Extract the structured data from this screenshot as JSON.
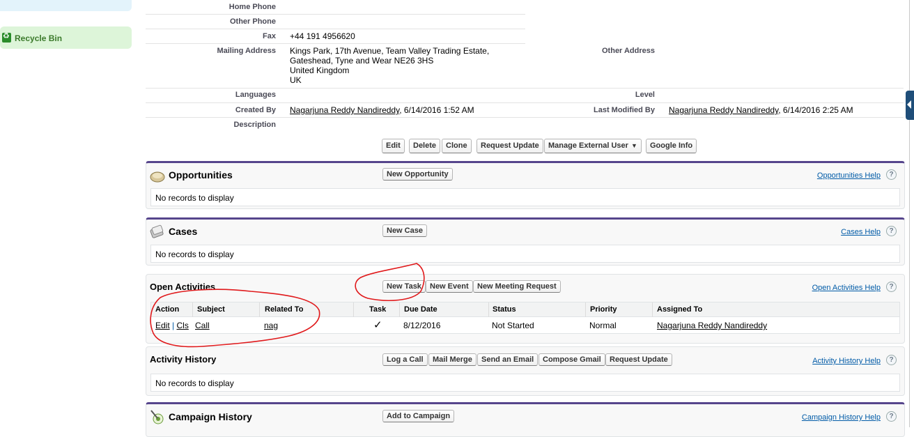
{
  "sidebar": {
    "recycle_bin_label": "Recycle Bin"
  },
  "details": {
    "home_phone_label": "Home Phone",
    "other_phone_label": "Other Phone",
    "fax_label": "Fax",
    "fax_value": "+44 191 4956620",
    "mailing_address_label": "Mailing Address",
    "mailing_address_lines": [
      "Kings Park, 17th Avenue, Team Valley Trading Estate,",
      "Gateshead, Tyne and Wear NE26 3HS",
      "United Kingdom",
      "UK"
    ],
    "other_address_label": "Other Address",
    "languages_label": "Languages",
    "level_label": "Level",
    "created_by_label": "Created By",
    "created_by_user": "Nagarjuna Reddy Nandireddy",
    "created_by_date": ", 6/14/2016 1:52 AM",
    "last_modified_by_label": "Last Modified By",
    "last_modified_by_user": "Nagarjuna Reddy Nandireddy",
    "last_modified_by_date": ", 6/14/2016 2:25 AM",
    "description_label": "Description"
  },
  "detail_buttons": {
    "edit": "Edit",
    "delete": "Delete",
    "clone": "Clone",
    "request_update": "Request Update",
    "manage_external_user": "Manage External User",
    "google_info": "Google Info"
  },
  "opportunities": {
    "title": "Opportunities",
    "new_button": "New Opportunity",
    "help": "Opportunities Help",
    "empty": "No records to display"
  },
  "cases": {
    "title": "Cases",
    "new_button": "New Case",
    "help": "Cases Help",
    "empty": "No records to display"
  },
  "open_activities": {
    "title": "Open Activities",
    "new_task_button": "New Task",
    "new_event_button": "New Event",
    "new_meeting_request_button": "New Meeting Request",
    "help": "Open Activities Help",
    "columns": [
      "Action",
      "Subject",
      "Related To",
      "Task",
      "Due Date",
      "Status",
      "Priority",
      "Assigned To"
    ],
    "row": {
      "action_edit": "Edit",
      "action_sep": " | ",
      "action_close": "Cls",
      "subject": "Call",
      "related_to": "nag",
      "task_check": "✓",
      "due_date": "8/12/2016",
      "status": "Not Started",
      "priority": "Normal",
      "assigned_to": "Nagarjuna Reddy Nandireddy"
    }
  },
  "activity_history": {
    "title": "Activity History",
    "buttons": {
      "log_a_call": "Log a Call",
      "mail_merge": "Mail Merge",
      "send_an_email": "Send an Email",
      "compose_gmail": "Compose Gmail",
      "request_update": "Request Update"
    },
    "help": "Activity History Help",
    "empty": "No records to display"
  },
  "campaign_history": {
    "title": "Campaign History",
    "add_button": "Add to Campaign",
    "help": "Campaign History Help"
  },
  "help_glyph": "?",
  "colors": {
    "related_list_border": "#56458c",
    "help_link": "#015ba7",
    "annotation": "#e0191b"
  }
}
